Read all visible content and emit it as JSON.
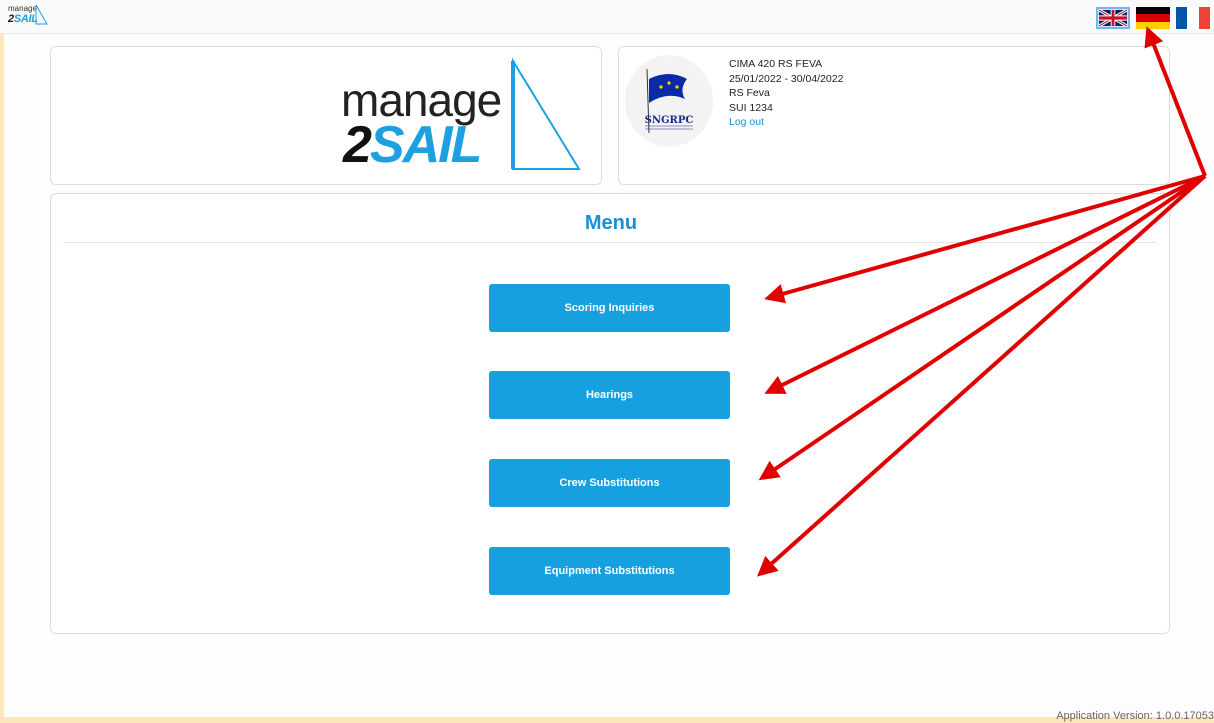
{
  "app": {
    "mini_logo_top": "manage",
    "mini_logo_bottom_dark": "2",
    "mini_logo_bottom_blue": "SAIL",
    "logo_manage": "manage",
    "logo_two": "2",
    "logo_sail": "SAIL",
    "brand_blue": "#1ea0e0"
  },
  "languages": [
    {
      "code": "en",
      "icon": "uk-flag-icon",
      "selected": true
    },
    {
      "code": "de",
      "icon": "germany-flag-icon",
      "selected": false
    },
    {
      "code": "fr",
      "icon": "france-flag-icon",
      "selected": false
    }
  ],
  "event": {
    "club_logo_text": "SNGRPC",
    "name": "CIMA 420 RS FEVA",
    "dates": "25/01/2022 - 30/04/2022",
    "class": "RS Feva",
    "sail_number": "SUI 1234",
    "logout_label": "Log out"
  },
  "menu": {
    "title": "Menu",
    "items": [
      {
        "label": "Scoring Inquiries"
      },
      {
        "label": "Hearings"
      },
      {
        "label": "Crew Substitutions"
      },
      {
        "label": "Equipment Substitutions"
      }
    ]
  },
  "footer": {
    "version": "Application Version: 1.0.0.17053"
  },
  "annotation": {
    "arrow_color": "#e00000"
  }
}
